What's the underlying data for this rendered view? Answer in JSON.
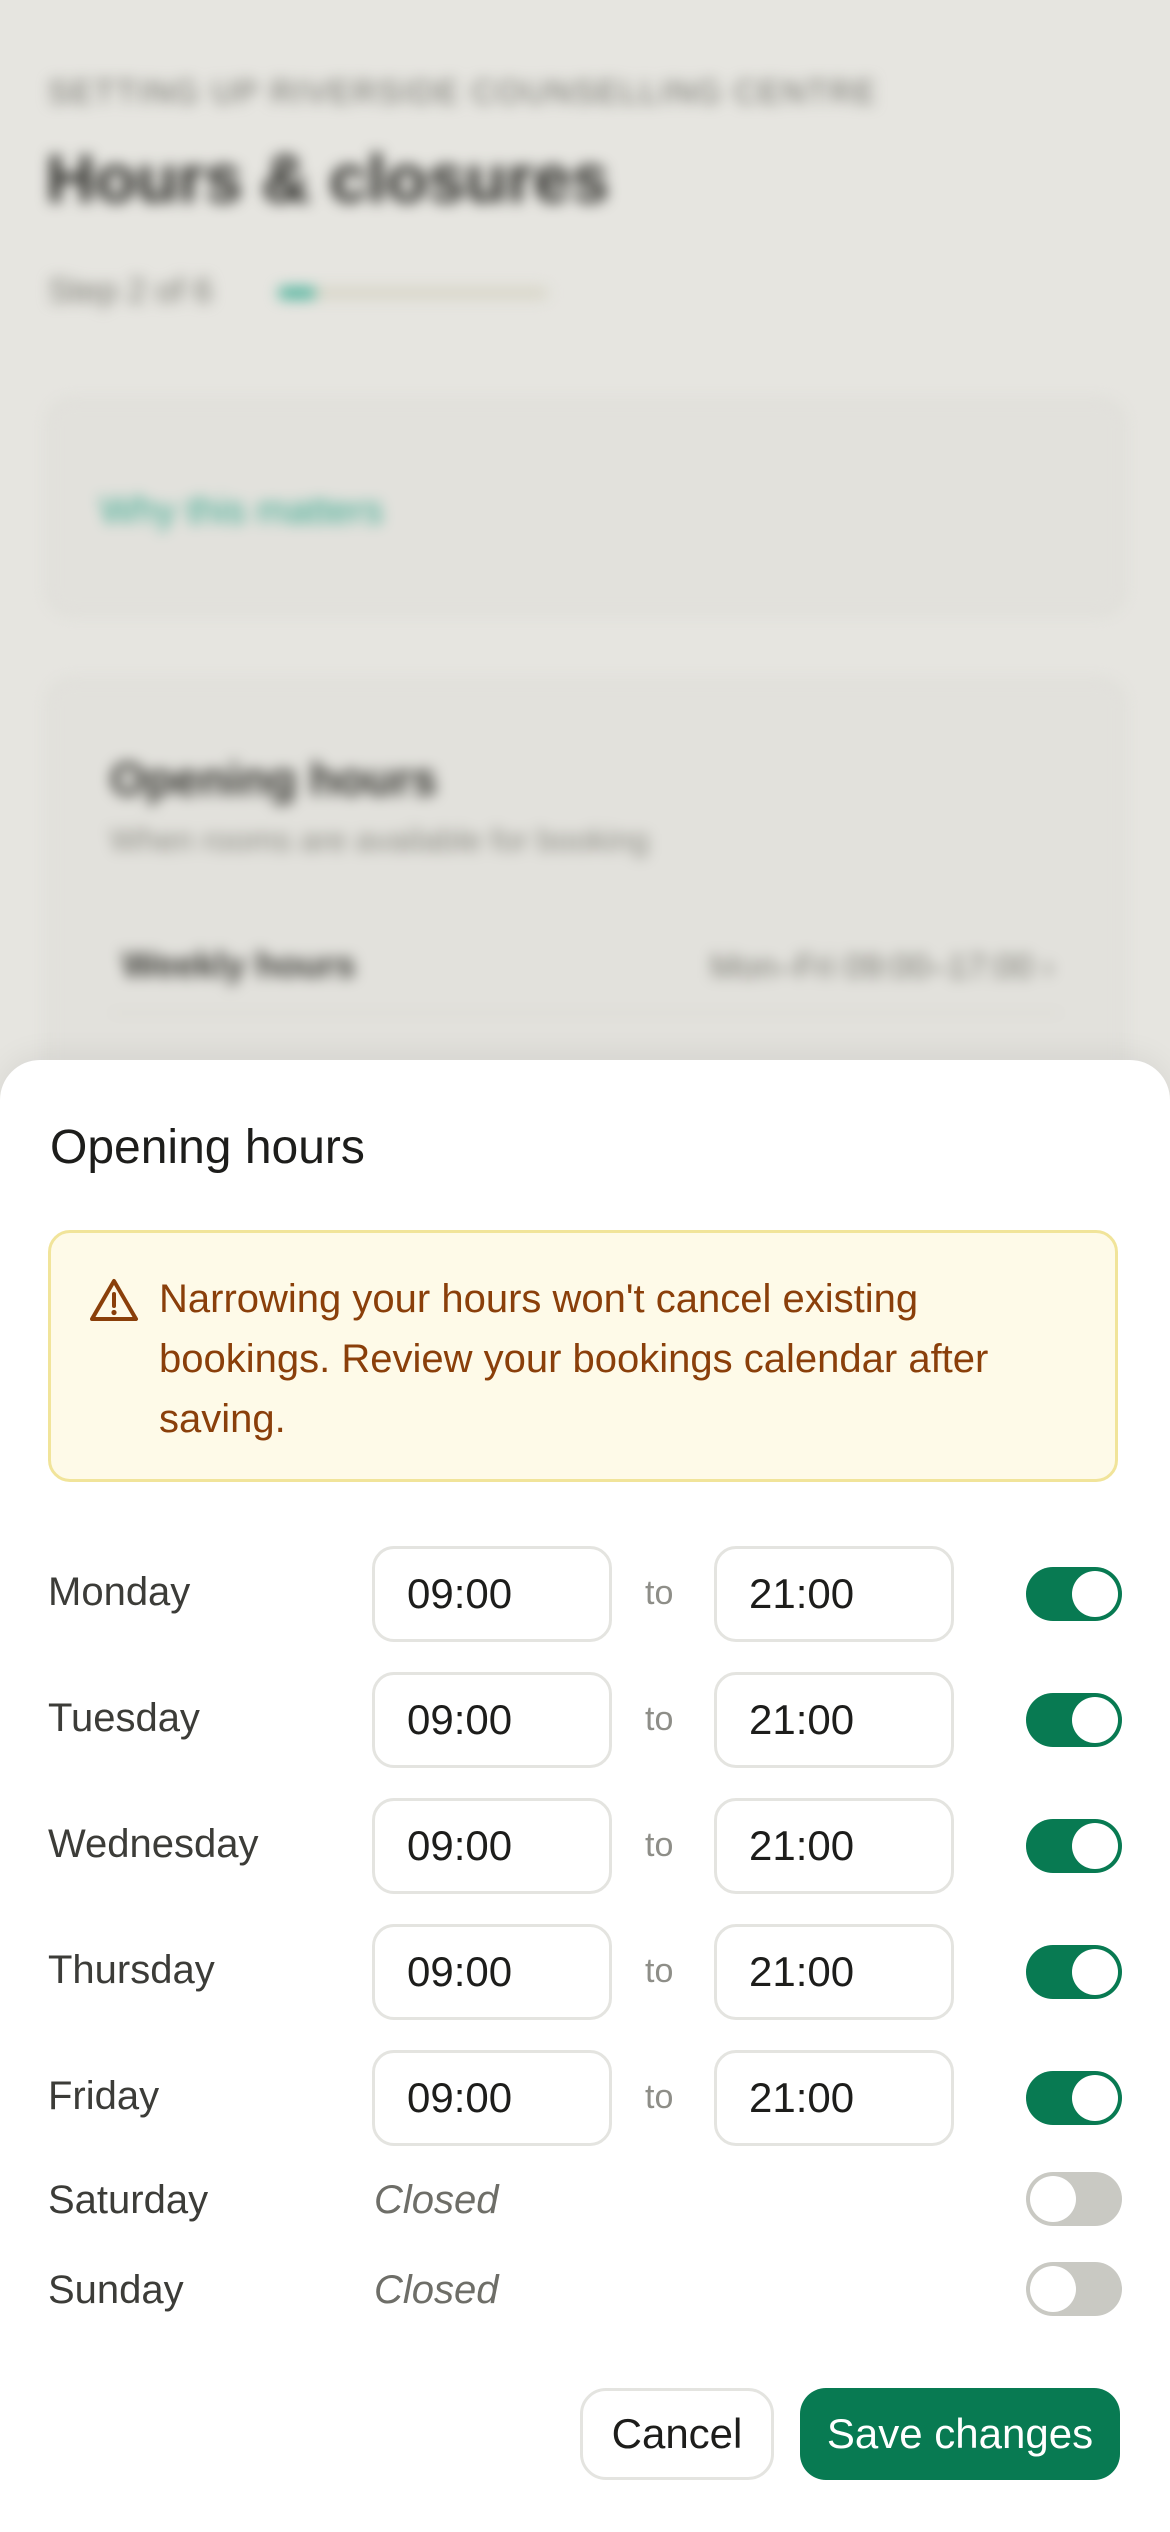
{
  "background": {
    "eyebrow": "Setting up Riverside Counselling Centre",
    "title": "Hours & closures",
    "step": "Step 2 of 6",
    "progress_fraction": 0.14,
    "info_link": "Why this matters",
    "card_title": "Opening hours",
    "card_subtitle": "When rooms are available for booking",
    "row_label": "Weekly hours",
    "row_value": "Mon–Fri 09:00–17:00 ›"
  },
  "sheet": {
    "title": "Opening hours",
    "warning": "Narrowing your hours won't cancel existing bookings. Review your bookings calendar after saving.",
    "to_label": "to",
    "closed_label": "Closed",
    "days": [
      {
        "name": "Monday",
        "open": "09:00",
        "close": "21:00",
        "enabled": true
      },
      {
        "name": "Tuesday",
        "open": "09:00",
        "close": "21:00",
        "enabled": true
      },
      {
        "name": "Wednesday",
        "open": "09:00",
        "close": "21:00",
        "enabled": true
      },
      {
        "name": "Thursday",
        "open": "09:00",
        "close": "21:00",
        "enabled": true
      },
      {
        "name": "Friday",
        "open": "09:00",
        "close": "21:00",
        "enabled": true
      },
      {
        "name": "Saturday",
        "open": "",
        "close": "",
        "enabled": false
      },
      {
        "name": "Sunday",
        "open": "",
        "close": "",
        "enabled": false
      }
    ],
    "cancel_label": "Cancel",
    "save_label": "Save changes"
  },
  "colors": {
    "accent": "#087a52",
    "warning_text": "#8a3f0a",
    "warning_bg": "#fefae8",
    "warning_border": "#f1e49a"
  },
  "icons": {
    "warning": "warning-triangle-icon"
  }
}
